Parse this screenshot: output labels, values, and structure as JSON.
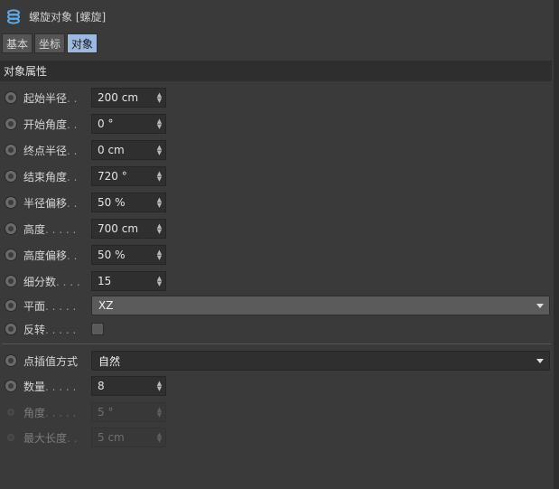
{
  "title": "螺旋对象 [螺旋]",
  "tabs": [
    {
      "label": "基本",
      "active": false
    },
    {
      "label": "坐标",
      "active": false
    },
    {
      "label": "对象",
      "active": true
    }
  ],
  "section_header": "对象属性",
  "params": [
    {
      "label": "起始半径",
      "dots": ". .",
      "value": "200 cm"
    },
    {
      "label": "开始角度",
      "dots": ". .",
      "value": "0 °"
    },
    {
      "label": "终点半径",
      "dots": ". .",
      "value": "0 cm"
    },
    {
      "label": "结束角度",
      "dots": ". .",
      "value": "720 °"
    },
    {
      "label": "半径偏移",
      "dots": ". .",
      "value": "50 %"
    },
    {
      "label": "高度",
      "dots": ". . . . .",
      "value": "700 cm"
    },
    {
      "label": "高度偏移",
      "dots": ". .",
      "value": "50 %"
    },
    {
      "label": "细分数",
      "dots": ". . . .",
      "value": "15"
    }
  ],
  "plane": {
    "label": "平面",
    "dots": ". . . . .",
    "value": "XZ"
  },
  "reverse": {
    "label": "反转",
    "dots": ". . . . .",
    "checked": false
  },
  "interpolation": {
    "label": "点插值方式",
    "value": "自然"
  },
  "count": {
    "label": "数量",
    "dots": ". . . . .",
    "value": "8"
  },
  "angle": {
    "label": "角度",
    "dots": ". . . . .",
    "value": "5 °"
  },
  "max_length": {
    "label": "最大长度",
    "dots": ". .",
    "value": "5 cm"
  },
  "icons": {
    "title": "spiral-spline-icon",
    "spinner": "spinner-arrows-icon",
    "dropdown": "chevron-down-icon"
  },
  "colors": {
    "active_tab": "#9db9e0",
    "panel": "#3a3a3a",
    "field": "#2f2f2f"
  }
}
